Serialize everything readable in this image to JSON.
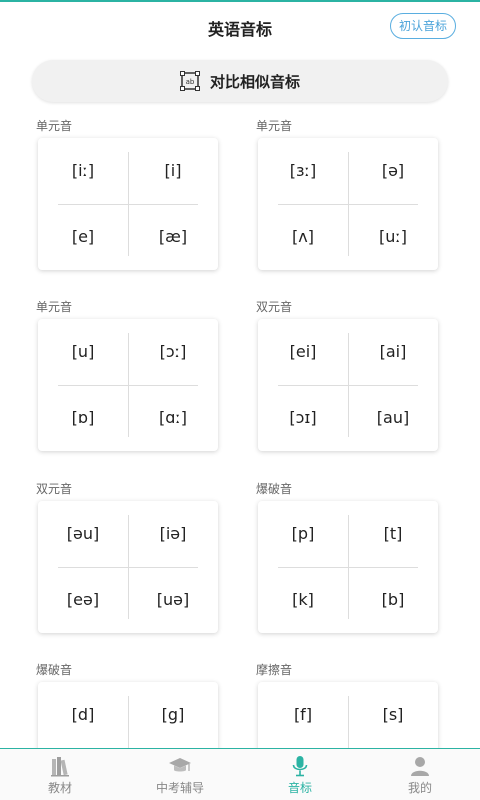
{
  "header": {
    "title": "英语音标",
    "learn_button": "初认音标"
  },
  "compare": {
    "label": "对比相似音标",
    "icon": "ab-compare-icon"
  },
  "groups": [
    {
      "title": "单元音",
      "symbols": [
        "[iː]",
        "[i]",
        "[e]",
        "[æ]"
      ]
    },
    {
      "title": "单元音",
      "symbols": [
        "[ɜː]",
        "[ə]",
        "[ʌ]",
        "[uː]"
      ]
    },
    {
      "title": "单元音",
      "symbols": [
        "[u]",
        "[ɔː]",
        "[ɒ]",
        "[ɑː]"
      ]
    },
    {
      "title": "双元音",
      "symbols": [
        "[ei]",
        "[ai]",
        "[ɔɪ]",
        "[au]"
      ]
    },
    {
      "title": "双元音",
      "symbols": [
        "[əu]",
        "[iə]",
        "[eə]",
        "[uə]"
      ]
    },
    {
      "title": "爆破音",
      "symbols": [
        "[p]",
        "[t]",
        "[k]",
        "[b]"
      ]
    },
    {
      "title": "爆破音",
      "symbols": [
        "[d]",
        "[g]",
        "",
        ""
      ]
    },
    {
      "title": "摩擦音",
      "symbols": [
        "[f]",
        "[s]",
        "",
        ""
      ]
    }
  ],
  "tabs": [
    {
      "label": "教材",
      "icon": "books-icon",
      "active": false
    },
    {
      "label": "中考辅导",
      "icon": "graduation-cap-icon",
      "active": false
    },
    {
      "label": "音标",
      "icon": "microphone-icon",
      "active": true
    },
    {
      "label": "我的",
      "icon": "user-icon",
      "active": false
    }
  ],
  "colors": {
    "accent": "#2bb3a3",
    "button_border": "#5aaee0",
    "inactive_tab": "#888888"
  }
}
